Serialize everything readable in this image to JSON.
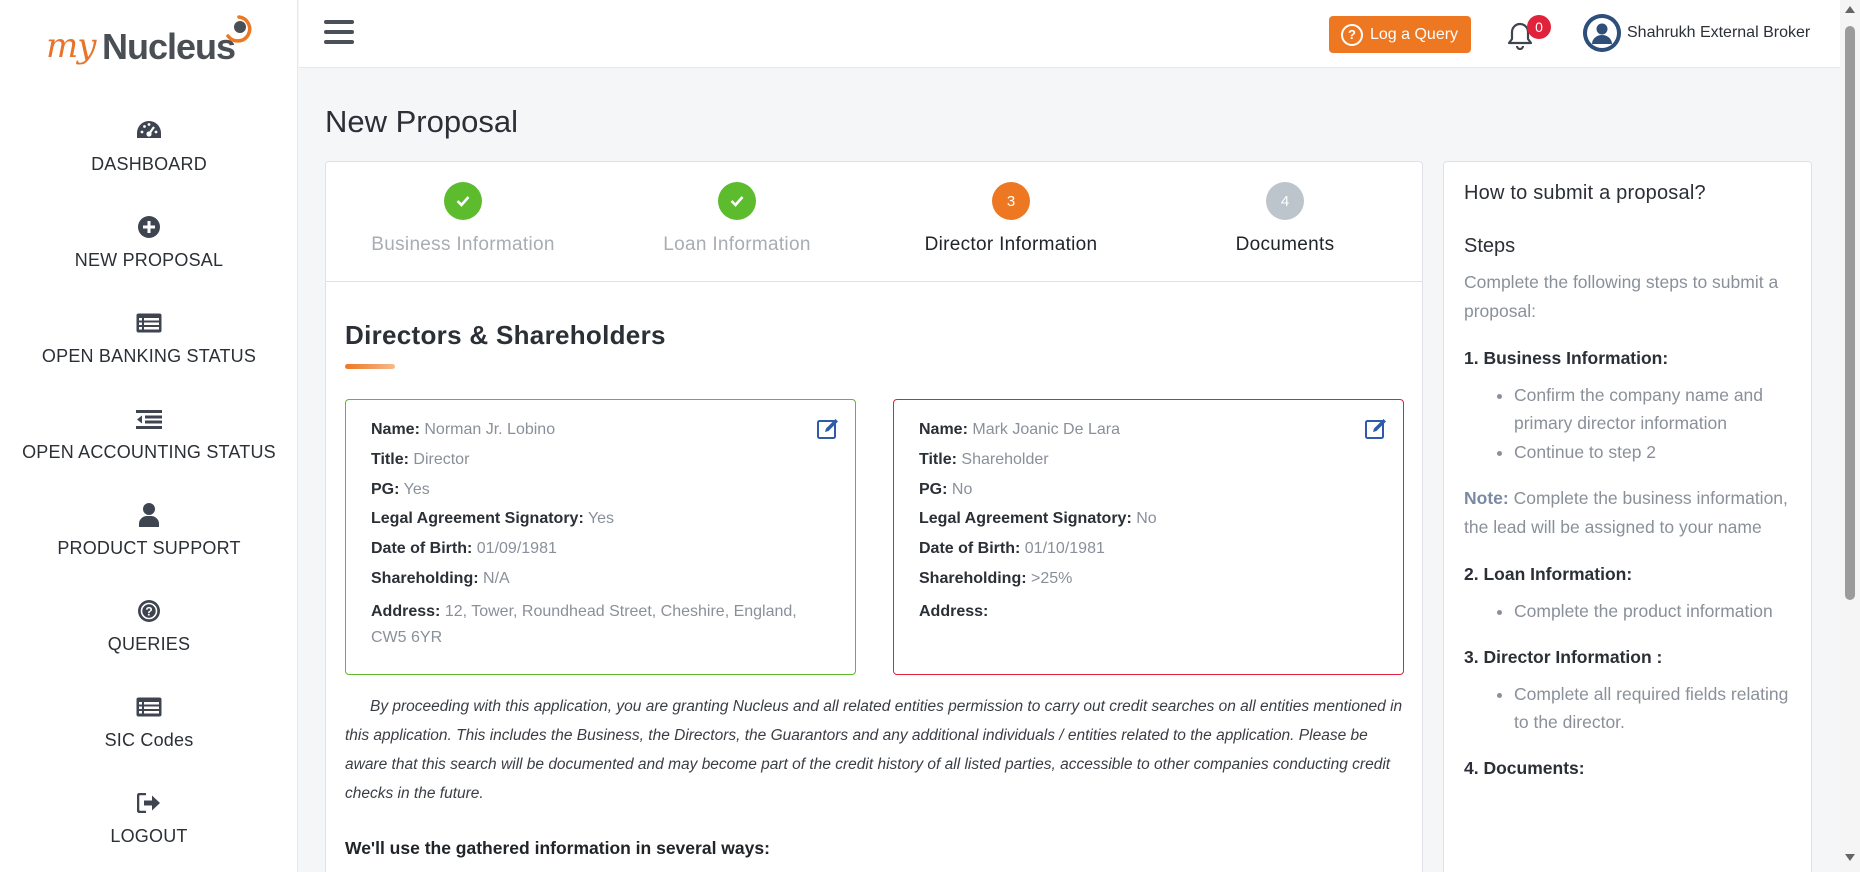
{
  "brand": {
    "prefix": "my",
    "name": "Nucleus",
    "accent": "#ee7722"
  },
  "sidebar": {
    "items": [
      {
        "label": "DASHBOARD",
        "icon": "dashboard-gauge-icon"
      },
      {
        "label": "NEW PROPOSAL",
        "icon": "plus-circle-icon"
      },
      {
        "label": "OPEN BANKING STATUS",
        "icon": "list-card-icon"
      },
      {
        "label": "OPEN ACCOUNTING STATUS",
        "icon": "indent-list-icon"
      },
      {
        "label": "PRODUCT SUPPORT",
        "icon": "user-icon"
      },
      {
        "label": "QUERIES",
        "icon": "question-circle-icon"
      },
      {
        "label": "SIC Codes",
        "icon": "list-card-icon"
      },
      {
        "label": "LOGOUT",
        "icon": "sign-out-icon"
      }
    ]
  },
  "topbar": {
    "query_button": "Log a Query",
    "notification_count": "0",
    "user_name": "Shahrukh External Broker"
  },
  "page": {
    "title": "New Proposal"
  },
  "stepper": {
    "steps": [
      {
        "number": "1",
        "label": "Business Information",
        "state": "done"
      },
      {
        "number": "2",
        "label": "Loan Information",
        "state": "done"
      },
      {
        "number": "3",
        "label": "Director Information",
        "state": "active"
      },
      {
        "number": "4",
        "label": "Documents",
        "state": "pending"
      }
    ]
  },
  "section": {
    "title": "Directors & Shareholders"
  },
  "directors": [
    {
      "name_label": "Name:",
      "name": "Norman Jr. Lobino",
      "title_label": "Title:",
      "title": "Director",
      "pg_label": "PG:",
      "pg": "Yes",
      "signatory_label": "Legal Agreement Signatory:",
      "signatory": "Yes",
      "dob_label": "Date of Birth:",
      "dob": "01/09/1981",
      "shareholding_label": "Shareholding:",
      "shareholding": "N/A",
      "address_label": "Address:",
      "address": "12, Tower, Roundhead Street, Cheshire, England, CW5 6YR",
      "border_color": "#5dbb2e"
    },
    {
      "name_label": "Name:",
      "name": "Mark Joanic De Lara",
      "title_label": "Title:",
      "title": "Shareholder",
      "pg_label": "PG:",
      "pg": "No",
      "signatory_label": "Legal Agreement Signatory:",
      "signatory": "No",
      "dob_label": "Date of Birth:",
      "dob": "01/10/1981",
      "shareholding_label": "Shareholding:",
      "shareholding": ">25%",
      "address_label": "Address:",
      "address": "",
      "border_color": "#e0233a"
    }
  ],
  "disclaimer": "By proceeding with this application, you are granting Nucleus and all related entities permission to carry out credit searches on all entities mentioned in this application. This includes the Business, the Directors, the Guarantors and any additional individuals / entities related to the application. Please be aware that this search will be documented and may become part of the credit history of all listed parties, accessible to other companies conducting credit checks in the future.",
  "ways_heading": "We'll use the gathered information in several ways:",
  "help": {
    "title": "How to submit a proposal?",
    "steps_heading": "Steps",
    "intro": "Complete the following steps to submit a proposal:",
    "s1_heading": "1. Business Information:",
    "s1_items": [
      "Confirm the company name and primary director information",
      "Continue to step 2"
    ],
    "note_label": "Note:",
    "note_text": " Complete the business information, the lead will be assigned to your name",
    "s2_heading": "2. Loan Information:",
    "s2_items": [
      "Complete the product information"
    ],
    "s3_heading": "3. Director Information :",
    "s3_items": [
      "Complete all required fields relating to the director."
    ],
    "s4_heading": "4. Documents:"
  }
}
